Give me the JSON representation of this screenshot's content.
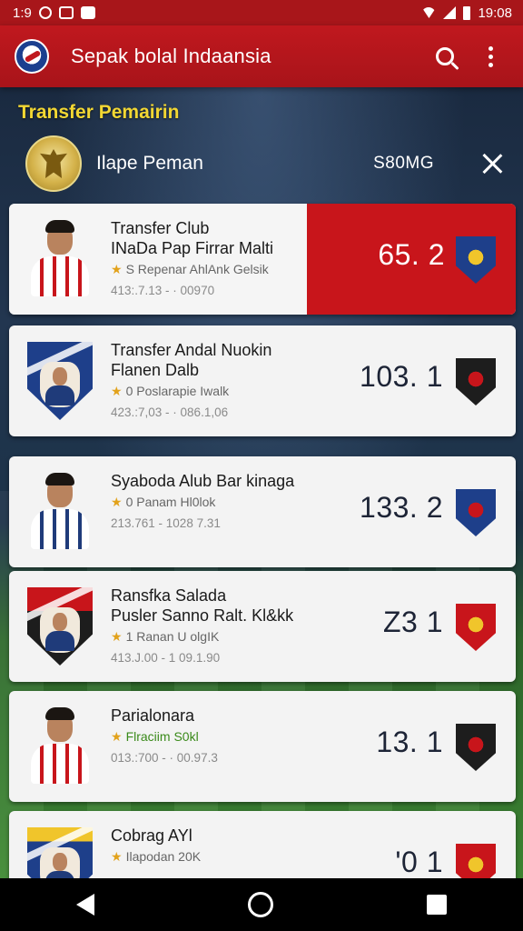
{
  "status_bar": {
    "time_left": "1:9",
    "time_right": "19:08"
  },
  "app_bar": {
    "title": "Sepak bolal Indaansia"
  },
  "section": {
    "title": "Transfer Pemairin"
  },
  "header": {
    "name": "Ilape Peman",
    "code": "S80MG"
  },
  "cards": [
    {
      "line1": "Transfer Club",
      "line2": "INaDa Pap Firrar Malti",
      "line3": "S Repenar AhlAnk Gelsik",
      "line4": "413:.7.13 - · 00970",
      "value": "65. 2",
      "highlight": true,
      "crest_color": "#1e3f8a",
      "crest_accent": "#f0c52b",
      "avatar": "player-red"
    },
    {
      "line1": "Transfer Andal Nuokin",
      "line2": "Flanen Dalb",
      "line3": "0 Poslarapie Iwalk",
      "line4": "423.:7,03 - · 086.1,06",
      "value": "103. 1",
      "highlight": false,
      "crest_color": "#1d1d1d",
      "crest_accent": "#c8151b",
      "avatar": "badge-blue"
    },
    {
      "line1": "Syaboda Alub Bar kinaga",
      "line2": "",
      "line3": "0 Panam Hl0lok",
      "line4": "213.761 - 1028 7.31",
      "value": "133. 2",
      "highlight": false,
      "crest_color": "#1e3f8a",
      "crest_accent": "#c8151b",
      "avatar": "player-navy"
    },
    {
      "line1": "Ransfka Salada",
      "line2": "Pusler Sanno Ralt. Kl&kk",
      "line3": "1 Ranan U olgIK",
      "line4": "413.J.00 - 1 09.1.90",
      "value": "Z3 1",
      "highlight": false,
      "crest_color": "#c8151b",
      "crest_accent": "#f0c52b",
      "avatar": "badge-red"
    },
    {
      "line1": "Parialonara",
      "line2": "",
      "line3": "Flraciim S0kl",
      "line4": "013.:700 - · 00.97.3",
      "value": "13. 1",
      "highlight": false,
      "crest_color": "#1d1d1d",
      "crest_accent": "#c8151b",
      "avatar": "player-red"
    },
    {
      "line1": "Cobrag AYl",
      "line2": "",
      "line3": "Ilapodan 20K",
      "line4": "",
      "value": "'0 1",
      "highlight": false,
      "crest_color": "#c8151b",
      "crest_accent": "#f0c52b",
      "avatar": "badge-navy"
    }
  ]
}
